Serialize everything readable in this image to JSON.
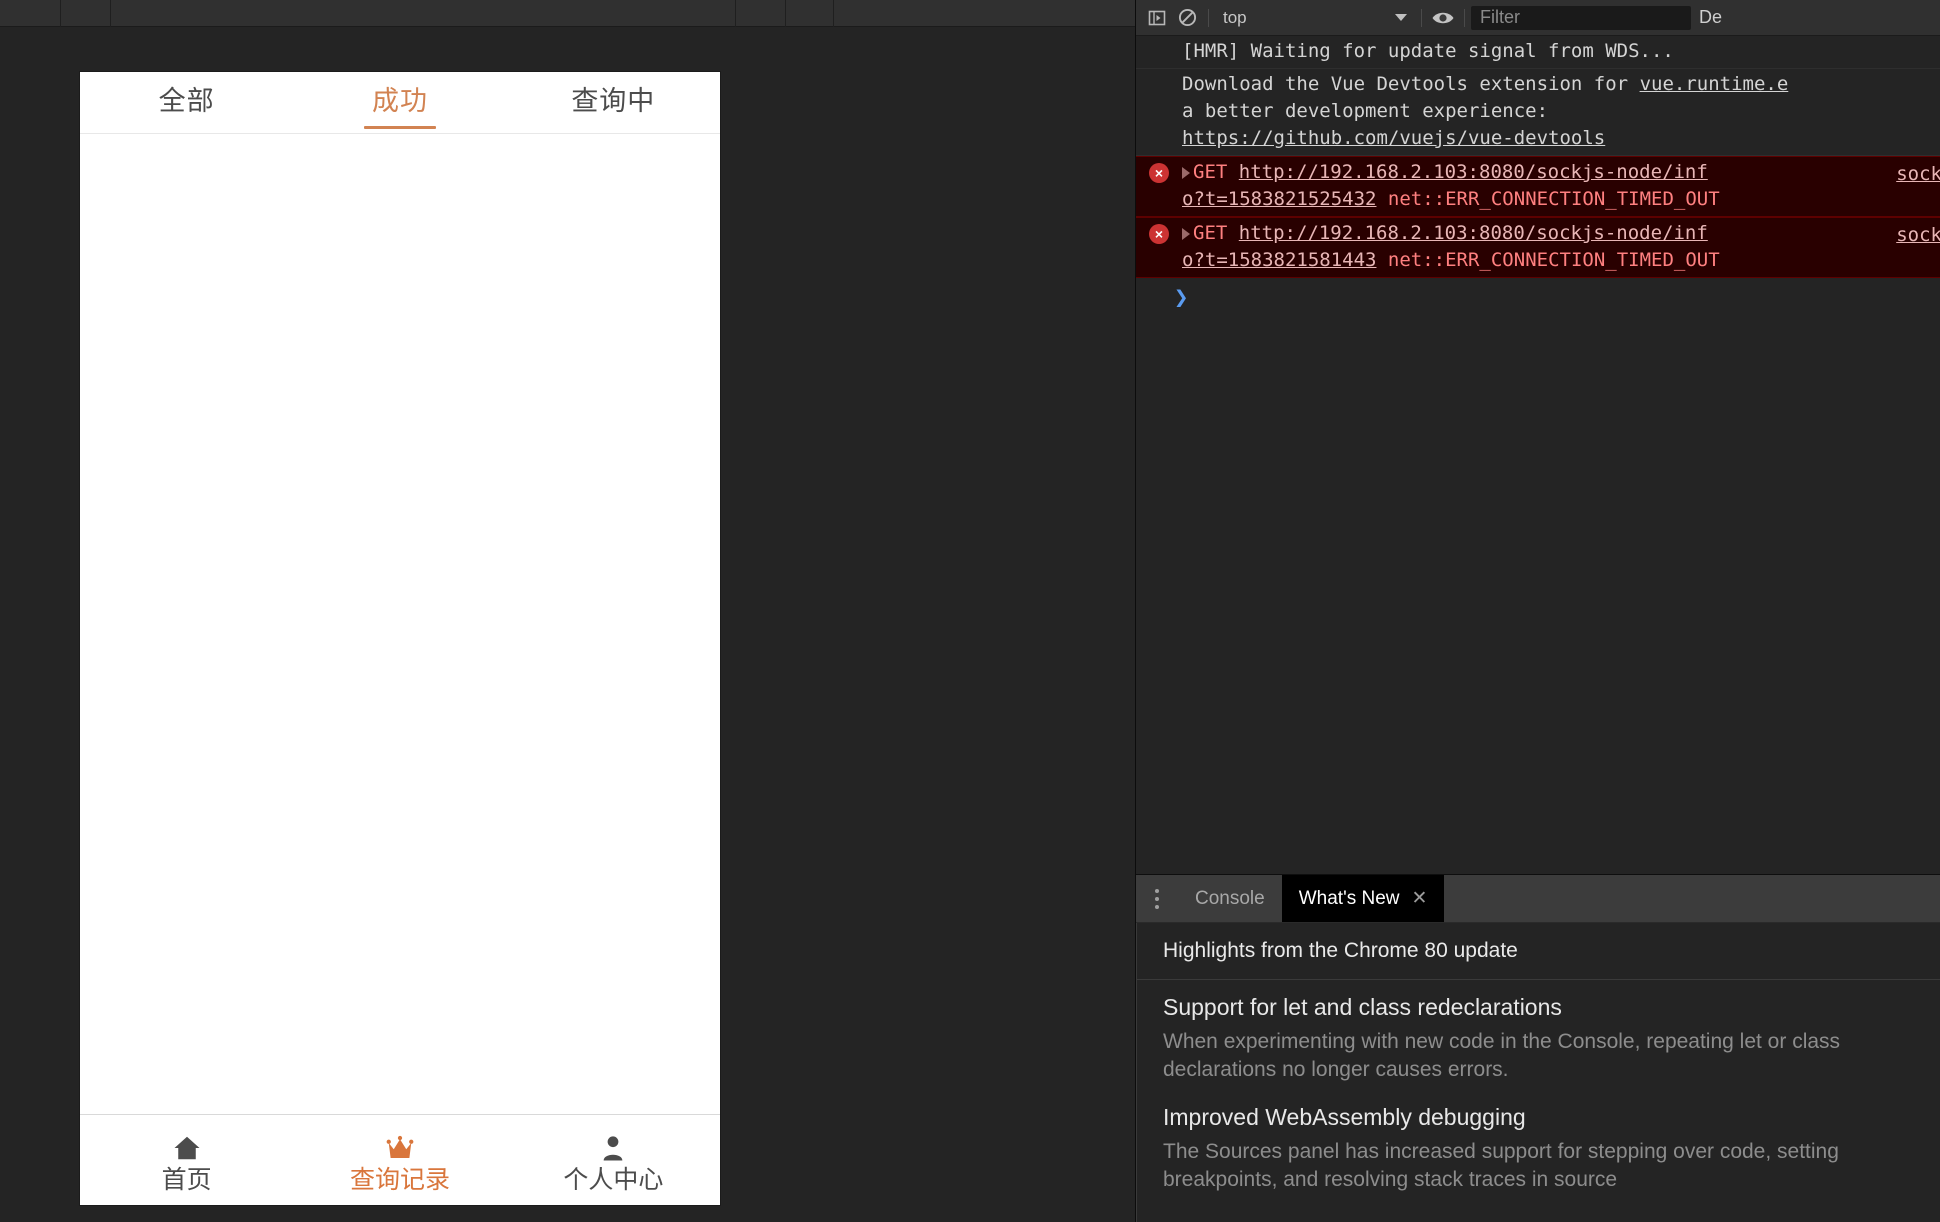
{
  "device_emulation": {
    "toolbar_dividers": [
      60,
      110,
      560,
      600,
      640
    ]
  },
  "mobile_app": {
    "tabs": [
      {
        "label": "全部",
        "active": false
      },
      {
        "label": "成功",
        "active": true
      },
      {
        "label": "查询中",
        "active": false
      }
    ],
    "accent_color": "#d28352",
    "bottom_nav": [
      {
        "label": "首页",
        "icon": "home-icon",
        "active": false
      },
      {
        "label": "查询记录",
        "icon": "crown-icon",
        "active": true
      },
      {
        "label": "个人中心",
        "icon": "person-icon",
        "active": false
      }
    ],
    "list_empty": true
  },
  "devtools": {
    "console_toolbar": {
      "sidebar_toggle_icon": "console-sidebar-icon",
      "clear_icon": "clear-console-icon",
      "context_selected": "top",
      "context_caret_icon": "chevron-down-icon",
      "eye_icon": "live-expression-icon",
      "filter_placeholder": "Filter",
      "levels_label": "De"
    },
    "console_messages": [
      {
        "type": "info",
        "icon": null,
        "text": "[HMR] Waiting for update signal from WDS...",
        "source": null
      },
      {
        "type": "log",
        "icon": null,
        "text_before": "Download the Vue Devtools extension for ",
        "link_inline": "vue.runtime.e",
        "text_line2": "a better development experience:",
        "link_line3": "https://github.com/vuejs/vue-devtools",
        "source": null
      },
      {
        "type": "error",
        "badge": "×",
        "method": "GET",
        "url_line1": "http://192.168.2.103:8080/sockjs-node/inf",
        "url_line2": "o?t=1583821525432",
        "error_text": "net::ERR_CONNECTION_TIMED_OUT",
        "source": "sock"
      },
      {
        "type": "error",
        "badge": "×",
        "method": "GET",
        "url_line1": "http://192.168.2.103:8080/sockjs-node/inf",
        "url_line2": "o?t=1583821581443",
        "error_text": "net::ERR_CONNECTION_TIMED_OUT",
        "source": "sock"
      }
    ],
    "prompt_glyph": "❯",
    "drawer": {
      "kebab_icon": "more-options-icon",
      "tabs": [
        {
          "label": "Console",
          "active": false,
          "closable": false
        },
        {
          "label": "What's New",
          "active": true,
          "closable": true,
          "close_icon": "close-icon"
        }
      ],
      "whats_new": {
        "header": "Highlights from the Chrome 80 update",
        "items": [
          {
            "title": "Support for let and class redeclarations",
            "body": "When experimenting with new code in the Console, repeating let or class declarations no longer causes errors."
          },
          {
            "title": "Improved WebAssembly debugging",
            "body": "The Sources panel has increased support for stepping over code, setting breakpoints, and resolving stack traces in source"
          }
        ]
      }
    }
  }
}
